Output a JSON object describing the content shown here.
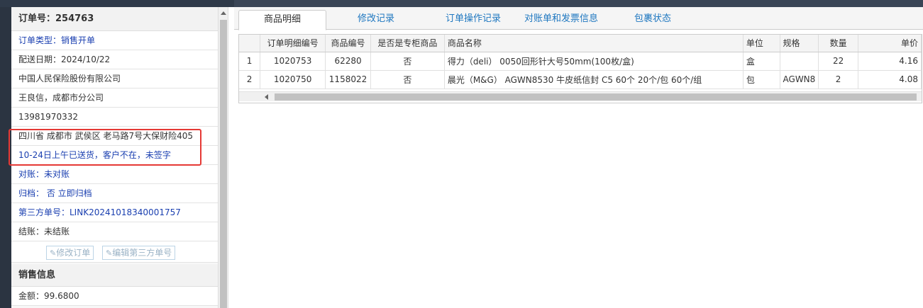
{
  "order": {
    "number_label": "订单号：254763",
    "type": "订单类型：销售开单",
    "delivery_date": "配送日期：2024/10/22",
    "company": "中国人民保险股份有限公司",
    "contact": "王良信，成都市分公司",
    "phone": "13981970332",
    "address": "四川省 成都市 武侯区 老马路7号大保财险405",
    "remark": "10-24日上午已送货，客户不在，未签字",
    "reconcile": "对账：未对账",
    "archive": "归档：  否 立即归档",
    "third_party_no": "第三方单号：LINK20241018340001757",
    "settle": "结账：未结账",
    "btn_edit_order": "修改订单",
    "btn_edit_third": "编辑第三方单号"
  },
  "sales": {
    "title": "销售信息",
    "amount": "金额：99.6800"
  },
  "tabs": [
    {
      "label": "商品明细"
    },
    {
      "label": "修改记录"
    },
    {
      "label": "订单操作记录"
    },
    {
      "label": "对账单和发票信息"
    },
    {
      "label": "包裹状态"
    }
  ],
  "table": {
    "headers": [
      "",
      "订单明细编号",
      "商品编号",
      "是否是专柜商品",
      "商品名称",
      "单位",
      "规格",
      "数量",
      "单价"
    ],
    "rows": [
      {
        "idx": "1",
        "detail_no": "1020753",
        "sku": "62280",
        "counter": "否",
        "name": "得力（deli） 0050回形针大号50mm(100枚/盒)",
        "unit": "盒",
        "spec": "",
        "qty": "22",
        "price": "4.16"
      },
      {
        "idx": "2",
        "detail_no": "1020750",
        "sku": "1158022",
        "counter": "否",
        "name": "晨光（M&G） AGWN8530 牛皮纸信封 C5 60个 20个/包 60个/组",
        "unit": "包",
        "spec": "AGWN8",
        "qty": "2",
        "price": "4.08"
      }
    ]
  },
  "colors": {
    "accent_blue": "#1a3fb0",
    "tab_link": "#1e77c0",
    "highlight_red": "#e53935"
  }
}
